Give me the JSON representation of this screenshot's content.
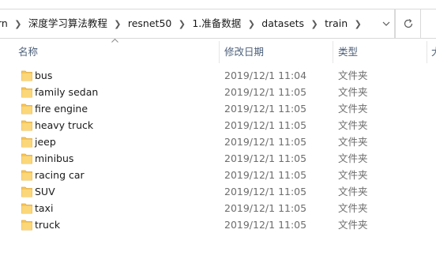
{
  "breadcrumb": {
    "items": [
      "rn",
      "深度学习算法教程",
      "resnet50",
      "1.准备数据",
      "datasets",
      "train"
    ]
  },
  "toolbar": {
    "dropdown_icon": "chevron-down-icon",
    "refresh_icon": "refresh-icon"
  },
  "columns": {
    "name": "名称",
    "date": "修改日期",
    "type": "类型",
    "size": "大"
  },
  "colors": {
    "folder": "#f6c659",
    "header_text": "#4c607a",
    "meta_text": "#6d6d6d"
  },
  "files": [
    {
      "name": "bus",
      "date": "2019/12/1 11:04",
      "type": "文件夹"
    },
    {
      "name": "family sedan",
      "date": "2019/12/1 11:05",
      "type": "文件夹"
    },
    {
      "name": "fire engine",
      "date": "2019/12/1 11:05",
      "type": "文件夹"
    },
    {
      "name": "heavy truck",
      "date": "2019/12/1 11:05",
      "type": "文件夹"
    },
    {
      "name": "jeep",
      "date": "2019/12/1 11:05",
      "type": "文件夹"
    },
    {
      "name": "minibus",
      "date": "2019/12/1 11:05",
      "type": "文件夹"
    },
    {
      "name": "racing car",
      "date": "2019/12/1 11:05",
      "type": "文件夹"
    },
    {
      "name": "SUV",
      "date": "2019/12/1 11:05",
      "type": "文件夹"
    },
    {
      "name": "taxi",
      "date": "2019/12/1 11:05",
      "type": "文件夹"
    },
    {
      "name": "truck",
      "date": "2019/12/1 11:05",
      "type": "文件夹"
    }
  ]
}
